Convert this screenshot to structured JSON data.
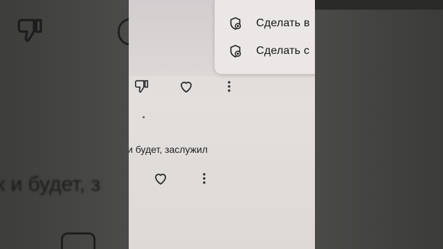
{
  "menu": {
    "items": [
      {
        "label": "Сделать в",
        "icon": "add-circle-icon"
      },
      {
        "label": "Сделать с",
        "icon": "add-circle-icon"
      }
    ]
  },
  "comment": {
    "text": "к и будет, заслужил"
  },
  "background": {
    "text": "к и будет, з"
  },
  "colors": {
    "screen": "#e0dcd9",
    "popup": "#ebe7e6",
    "text": "#151515",
    "frame": "#3a3a38"
  }
}
